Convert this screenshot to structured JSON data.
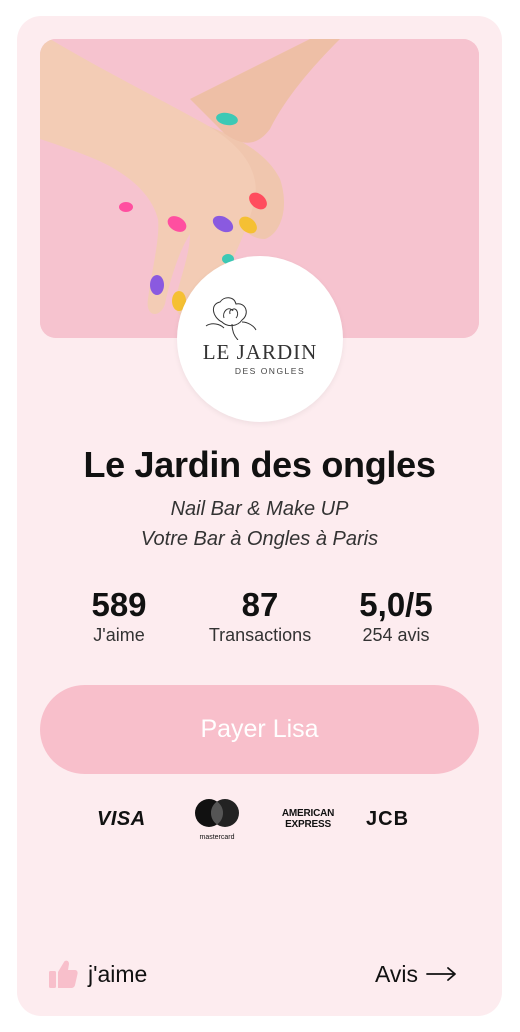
{
  "merchant": {
    "name": "Le Jardin des ongles",
    "tagline_1": "Nail Bar & Make UP",
    "tagline_2": "Votre Bar à Ongles à Paris",
    "logo_wordmark": "LE JARDIN",
    "logo_sub": "DES ONGLES"
  },
  "stats": [
    {
      "value": "589",
      "label": "J'aime"
    },
    {
      "value": "87",
      "label": "Transactions"
    },
    {
      "value": "5,0/5",
      "label": "254 avis"
    }
  ],
  "pay_button": {
    "label": "Payer Lisa"
  },
  "payment_methods": {
    "visa": "VISA",
    "mastercard": "mastercard",
    "amex_line1": "AMERICAN",
    "amex_line2": "EXPRESS",
    "jcb": "JCB"
  },
  "footer": {
    "like_label": "j'aime",
    "reviews_label": "Avis"
  },
  "icons": {
    "like": "thumbs-up-icon",
    "reviews_arrow": "arrow-right-icon"
  },
  "colors": {
    "card_bg": "#fdecef",
    "accent_pink": "#f8bfcb",
    "hero_bg": "#f6c3cf"
  }
}
